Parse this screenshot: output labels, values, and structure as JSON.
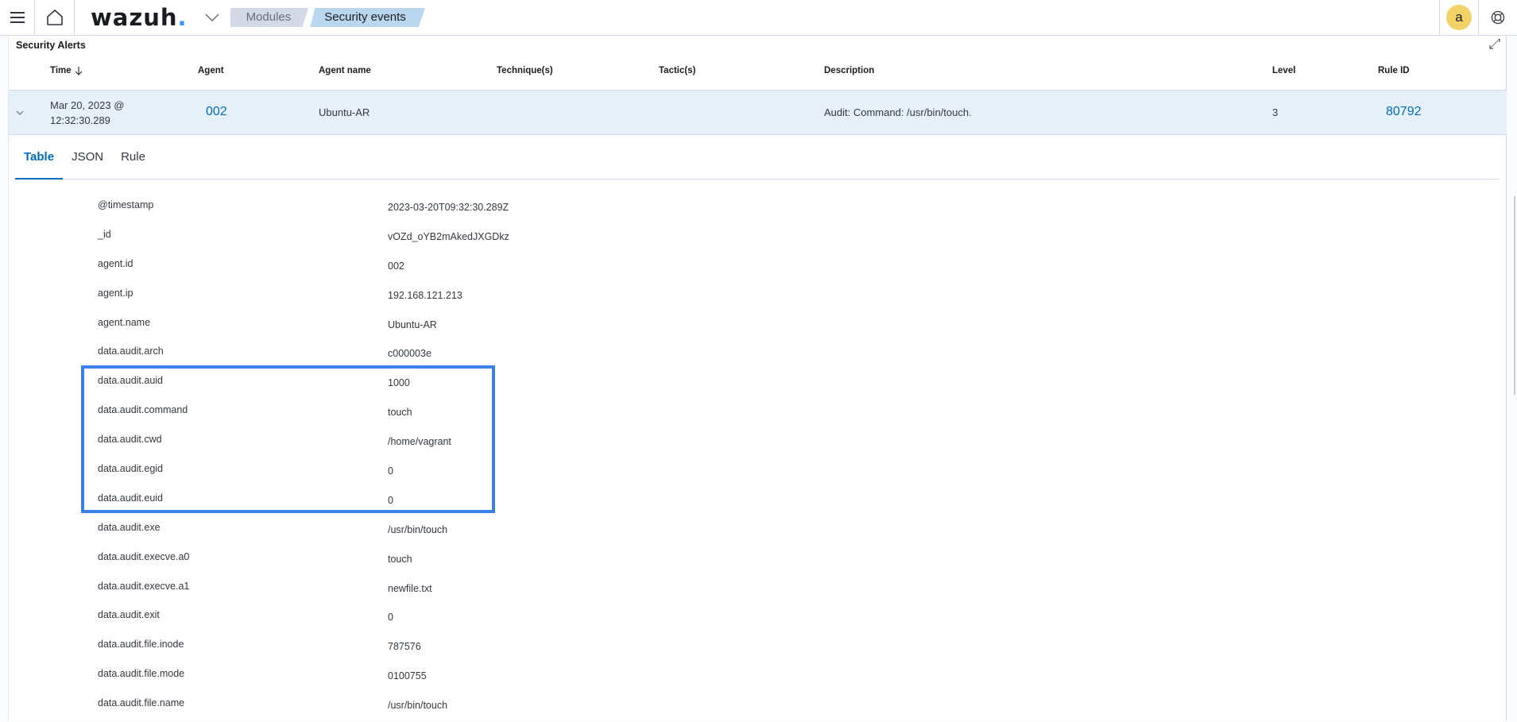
{
  "topbar": {
    "logo_text": "wazuh",
    "logo_dot": ".",
    "breadcrumbs": [
      "Modules",
      "Security events"
    ],
    "avatar_initial": "a",
    "accent_color": "#3595f9"
  },
  "panel": {
    "title": "Security Alerts",
    "columns": [
      "Time",
      "Agent",
      "Agent name",
      "Technique(s)",
      "Tactic(s)",
      "Description",
      "Level",
      "Rule ID"
    ],
    "sort_column": "Time",
    "sort_direction": "descending",
    "alert": {
      "time_line1": "Mar 20, 2023 @",
      "time_line2": "12:32:30.289",
      "agent": "002",
      "agent_name": "Ubuntu-AR",
      "techniques": "",
      "tactics": "",
      "description": "Audit: Command: /usr/bin/touch.",
      "level": "3",
      "rule_id": "80792"
    }
  },
  "tabs": [
    {
      "label": "Table",
      "active": true
    },
    {
      "label": "JSON",
      "active": false
    },
    {
      "label": "Rule",
      "active": false
    }
  ],
  "details": [
    {
      "key": "@timestamp",
      "value": "2023-03-20T09:32:30.289Z"
    },
    {
      "key": "_id",
      "value": "vOZd_oYB2mAkedJXGDkz"
    },
    {
      "key": "agent.id",
      "value": "002"
    },
    {
      "key": "agent.ip",
      "value": "192.168.121.213"
    },
    {
      "key": "agent.name",
      "value": "Ubuntu-AR"
    },
    {
      "key": "data.audit.arch",
      "value": "c000003e"
    },
    {
      "key": "data.audit.auid",
      "value": "1000"
    },
    {
      "key": "data.audit.command",
      "value": "touch"
    },
    {
      "key": "data.audit.cwd",
      "value": "/home/vagrant"
    },
    {
      "key": "data.audit.egid",
      "value": "0"
    },
    {
      "key": "data.audit.euid",
      "value": "0"
    },
    {
      "key": "data.audit.exe",
      "value": "/usr/bin/touch"
    },
    {
      "key": "data.audit.execve.a0",
      "value": "touch"
    },
    {
      "key": "data.audit.execve.a1",
      "value": "newfile.txt"
    },
    {
      "key": "data.audit.exit",
      "value": "0"
    },
    {
      "key": "data.audit.file.inode",
      "value": "787576"
    },
    {
      "key": "data.audit.file.mode",
      "value": "0100755"
    },
    {
      "key": "data.audit.file.name",
      "value": "/usr/bin/touch"
    }
  ],
  "highlight": {
    "color": "#3a82e8",
    "keys": [
      "data.audit.auid",
      "data.audit.command",
      "data.audit.cwd",
      "data.audit.egid",
      "data.audit.euid"
    ]
  }
}
